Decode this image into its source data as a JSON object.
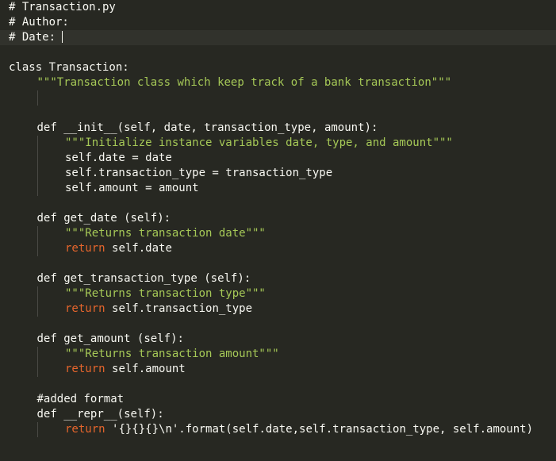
{
  "editor": {
    "colors": {
      "background": "#272822",
      "text": "#f8f8f2",
      "keyword_return": "#e5652c",
      "string": "#a6c957",
      "active_line": "#31322c",
      "indent_guide": "#4a4a45"
    },
    "active_line": 2,
    "lines": [
      {
        "indent": 0,
        "tokens": [
          {
            "t": "c",
            "v": "# Transaction.py"
          }
        ]
      },
      {
        "indent": 0,
        "tokens": [
          {
            "t": "c",
            "v": "# Author:"
          }
        ]
      },
      {
        "indent": 0,
        "tokens": [
          {
            "t": "c",
            "v": "# Date: "
          }
        ],
        "caret": true
      },
      {
        "indent": 0,
        "tokens": []
      },
      {
        "indent": 0,
        "tokens": [
          {
            "t": "k",
            "v": "class "
          },
          {
            "t": "o",
            "v": "Transaction:"
          }
        ]
      },
      {
        "indent": 1,
        "tokens": [
          {
            "t": "s",
            "v": "\"\"\"Transaction class which keep track of a bank transaction\"\"\""
          }
        ]
      },
      {
        "indent": 1,
        "guides": [
          1
        ],
        "tokens": []
      },
      {
        "indent": 1,
        "tokens": []
      },
      {
        "indent": 1,
        "tokens": [
          {
            "t": "k",
            "v": "def "
          },
          {
            "t": "o",
            "v": "__init__(self, date, transaction_type, amount):"
          }
        ]
      },
      {
        "indent": 2,
        "guides": [
          1
        ],
        "tokens": [
          {
            "t": "s",
            "v": "\"\"\"Initialize instance variables date, type, and amount\"\"\""
          }
        ]
      },
      {
        "indent": 2,
        "guides": [
          1
        ],
        "tokens": [
          {
            "t": "o",
            "v": "self.date = date"
          }
        ]
      },
      {
        "indent": 2,
        "guides": [
          1
        ],
        "tokens": [
          {
            "t": "o",
            "v": "self.transaction_type = transaction_type"
          }
        ]
      },
      {
        "indent": 2,
        "guides": [
          1
        ],
        "tokens": [
          {
            "t": "o",
            "v": "self.amount = amount"
          }
        ]
      },
      {
        "indent": 1,
        "tokens": []
      },
      {
        "indent": 1,
        "tokens": [
          {
            "t": "k",
            "v": "def "
          },
          {
            "t": "o",
            "v": "get_date (self):"
          }
        ]
      },
      {
        "indent": 2,
        "guides": [
          1
        ],
        "tokens": [
          {
            "t": "s",
            "v": "\"\"\"Returns transaction date\"\"\""
          }
        ]
      },
      {
        "indent": 2,
        "guides": [
          1
        ],
        "tokens": [
          {
            "t": "r",
            "v": "return "
          },
          {
            "t": "o",
            "v": "self.date"
          }
        ]
      },
      {
        "indent": 1,
        "tokens": []
      },
      {
        "indent": 1,
        "tokens": [
          {
            "t": "k",
            "v": "def "
          },
          {
            "t": "o",
            "v": "get_transaction_type (self):"
          }
        ]
      },
      {
        "indent": 2,
        "guides": [
          1
        ],
        "tokens": [
          {
            "t": "s",
            "v": "\"\"\"Returns transaction type\"\"\""
          }
        ]
      },
      {
        "indent": 2,
        "guides": [
          1
        ],
        "tokens": [
          {
            "t": "r",
            "v": "return "
          },
          {
            "t": "o",
            "v": "self.transaction_type"
          }
        ]
      },
      {
        "indent": 1,
        "tokens": []
      },
      {
        "indent": 1,
        "tokens": [
          {
            "t": "k",
            "v": "def "
          },
          {
            "t": "o",
            "v": "get_amount (self):"
          }
        ]
      },
      {
        "indent": 2,
        "guides": [
          1
        ],
        "tokens": [
          {
            "t": "s",
            "v": "\"\"\"Returns transaction amount\"\"\""
          }
        ]
      },
      {
        "indent": 2,
        "guides": [
          1
        ],
        "tokens": [
          {
            "t": "r",
            "v": "return "
          },
          {
            "t": "o",
            "v": "self.amount"
          }
        ]
      },
      {
        "indent": 1,
        "tokens": []
      },
      {
        "indent": 1,
        "tokens": [
          {
            "t": "o",
            "v": "#added format"
          }
        ]
      },
      {
        "indent": 1,
        "tokens": [
          {
            "t": "k",
            "v": "def "
          },
          {
            "t": "o",
            "v": "__repr__(self):"
          }
        ]
      },
      {
        "indent": 2,
        "guides": [
          1
        ],
        "tokens": [
          {
            "t": "r",
            "v": "return "
          },
          {
            "t": "o",
            "v": "'{}{}{}\\n'.format(self.date,self.transaction_type, self.amount)"
          }
        ]
      }
    ]
  }
}
